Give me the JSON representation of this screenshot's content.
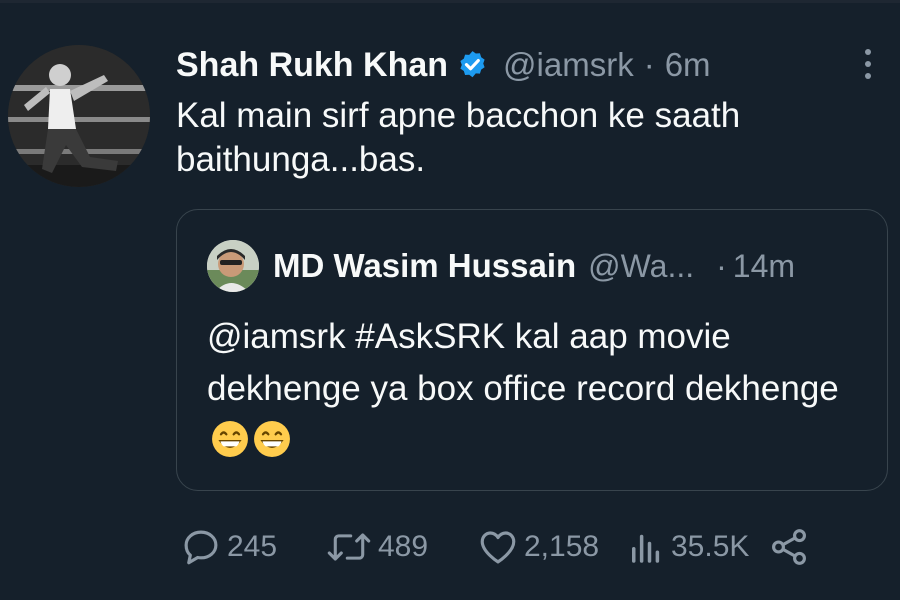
{
  "tweet": {
    "author": {
      "name": "Shah Rukh Khan",
      "handle": "@iamsrk",
      "verified": true
    },
    "timestamp": "6m",
    "separator": "·",
    "text": "Kal main sirf apne bacchon ke saath baithunga...bas."
  },
  "quoted_tweet": {
    "author": {
      "name": "MD Wasim Hussain",
      "handle": "@Wa..."
    },
    "separator": "·",
    "timestamp": "14m",
    "text": "@iamsrk #AskSRK  kal aap movie dekhenge ya box office record dekhenge",
    "emojis": [
      "grinning-face-with-smiling-eyes",
      "grinning-face-with-smiling-eyes"
    ]
  },
  "actions": {
    "replies": "245",
    "retweets": "489",
    "likes": "2,158",
    "views": "35.5K"
  },
  "icons": {
    "verified": "verified-badge-icon",
    "more": "more-options-icon",
    "reply": "reply-icon",
    "retweet": "retweet-icon",
    "like": "like-icon",
    "views": "views-icon",
    "share": "share-icon"
  },
  "colors": {
    "background": "#15202b",
    "primary_text": "#f7f9f9",
    "secondary_text": "#8b98a5",
    "border": "#38444d",
    "verified_blue": "#1d9bf0"
  }
}
